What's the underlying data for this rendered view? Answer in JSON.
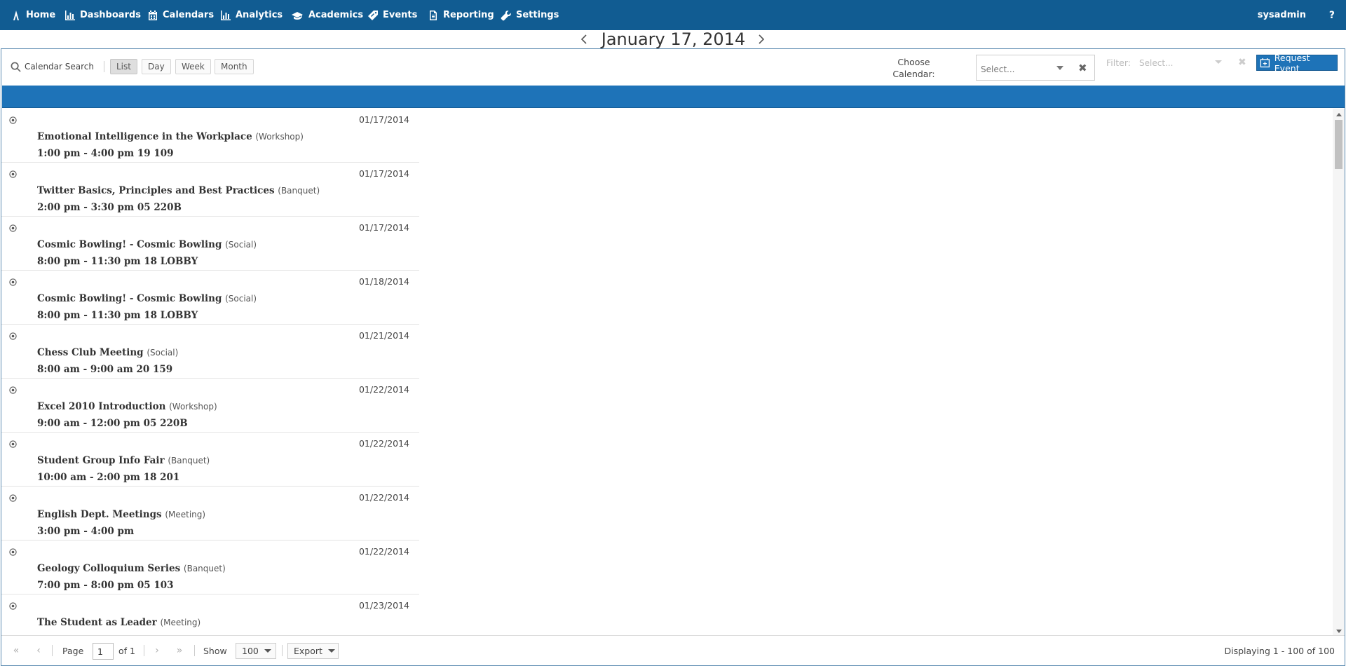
{
  "nav": {
    "items": [
      {
        "label": "Home",
        "icon": "home-icon"
      },
      {
        "label": "Dashboards",
        "icon": "bar-chart-icon"
      },
      {
        "label": "Calendars",
        "icon": "calendar-icon"
      },
      {
        "label": "Analytics",
        "icon": "bar-chart-icon"
      },
      {
        "label": "Academics",
        "icon": "graduation-cap-icon"
      },
      {
        "label": "Events",
        "icon": "tag-icon"
      },
      {
        "label": "Reporting",
        "icon": "document-icon"
      },
      {
        "label": "Settings",
        "icon": "wrench-icon"
      }
    ],
    "user": "sysadmin",
    "help": "?"
  },
  "date_header": {
    "title": "January 17, 2014"
  },
  "toolbar": {
    "search_label": "Calendar Search",
    "views": [
      "List",
      "Day",
      "Week",
      "Month"
    ],
    "active_view": "List",
    "choose_calendar_label": "Choose Calendar:",
    "calendar_placeholder": "Select...",
    "filter_label": "Filter:",
    "filter_placeholder": "Select...",
    "request_event_label": "Request Event"
  },
  "events": [
    {
      "date": "01/17/2014",
      "title": "Emotional Intelligence in the Workplace",
      "type": "(Workshop)",
      "time": "1:00 pm - 4:00 pm 19 109"
    },
    {
      "date": "01/17/2014",
      "title": "Twitter Basics, Principles and Best Practices",
      "type": "(Banquet)",
      "time": "2:00 pm - 3:30 pm 05 220B"
    },
    {
      "date": "01/17/2014",
      "title": "Cosmic Bowling! - Cosmic Bowling",
      "type": "(Social)",
      "time": "8:00 pm - 11:30 pm 18 LOBBY"
    },
    {
      "date": "01/18/2014",
      "title": "Cosmic Bowling! - Cosmic Bowling",
      "type": "(Social)",
      "time": "8:00 pm - 11:30 pm 18 LOBBY"
    },
    {
      "date": "01/21/2014",
      "title": "Chess Club Meeting",
      "type": "(Social)",
      "time": "8:00 am - 9:00 am 20 159"
    },
    {
      "date": "01/22/2014",
      "title": "Excel 2010 Introduction",
      "type": "(Workshop)",
      "time": "9:00 am - 12:00 pm 05 220B"
    },
    {
      "date": "01/22/2014",
      "title": "Student Group Info Fair",
      "type": "(Banquet)",
      "time": "10:00 am - 2:00 pm 18 201"
    },
    {
      "date": "01/22/2014",
      "title": "English Dept. Meetings",
      "type": "(Meeting)",
      "time": "3:00 pm - 4:00 pm"
    },
    {
      "date": "01/22/2014",
      "title": "Geology Colloquium Series",
      "type": "(Banquet)",
      "time": "7:00 pm - 8:00 pm 05 103"
    },
    {
      "date": "01/23/2014",
      "title": "The Student as Leader",
      "type": "(Meeting)",
      "time": ""
    }
  ],
  "pager": {
    "page_label": "Page",
    "page_value": "1",
    "of_label": "of 1",
    "show_label": "Show",
    "show_value": "100",
    "export_label": "Export",
    "display_text": "Displaying 1 - 100 of 100"
  }
}
